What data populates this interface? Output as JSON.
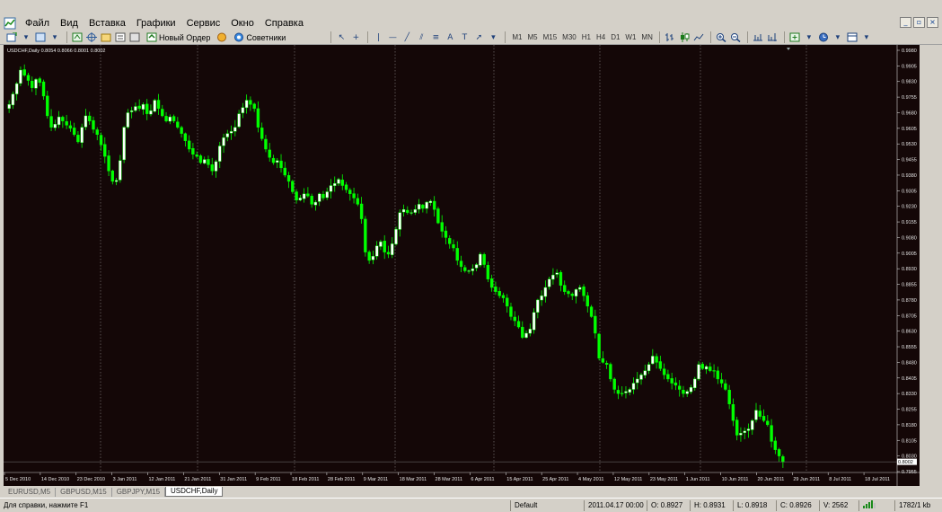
{
  "menubar": {
    "items": [
      "Файл",
      "Вид",
      "Вставка",
      "Графики",
      "Сервис",
      "Окно",
      "Справка"
    ],
    "window_controls": [
      "_",
      "▫",
      "×"
    ]
  },
  "toolbar": {
    "new_order_label": "Новый Ордер",
    "experts_label": "Советники",
    "timeframes": [
      "M1",
      "M5",
      "M15",
      "M30",
      "H1",
      "H4",
      "D1",
      "W1",
      "MN"
    ]
  },
  "chart": {
    "header": "USDCHF,Daily  0.8054 0.8066 0.8001 0.8002",
    "current_price_label": "0.8002",
    "bull_color": "#ffffff",
    "bear_color": "#00ff00",
    "background": "#140707"
  },
  "chart_data": {
    "type": "candlestick",
    "symbol": "USDCHF",
    "timeframe": "Daily",
    "ylim": [
      0.7955,
      0.998
    ],
    "y_ticks": [
      "0.9980",
      "0.9905",
      "0.9830",
      "0.9755",
      "0.9680",
      "0.9605",
      "0.9530",
      "0.9455",
      "0.9380",
      "0.9305",
      "0.9230",
      "0.9155",
      "0.9080",
      "0.9005",
      "0.8930",
      "0.8855",
      "0.8780",
      "0.8705",
      "0.8630",
      "0.8555",
      "0.8480",
      "0.8405",
      "0.8330",
      "0.8255",
      "0.8180",
      "0.8105",
      "0.8030",
      "0.7955"
    ],
    "x_ticks": [
      "5 Dec 2010",
      "14 Dec 2010",
      "23 Dec 2010",
      "3 Jan 2011",
      "12 Jan 2011",
      "21 Jan 2011",
      "31 Jan 2011",
      "9 Feb 2011",
      "18 Feb 2011",
      "28 Feb 2011",
      "9 Mar 2011",
      "18 Mar 2011",
      "28 Mar 2011",
      "6 Apr 2011",
      "15 Apr 2011",
      "25 Apr 2011",
      "4 May 2011",
      "12 May 2011",
      "23 May 2011",
      "1 Jun 2011",
      "10 Jun 2011",
      "20 Jun 2011",
      "29 Jun 2011",
      "8 Jul 2011",
      "18 Jul 2011"
    ],
    "close_path": [
      0.972,
      0.977,
      0.982,
      0.9885,
      0.986,
      0.9835,
      0.98,
      0.984,
      0.9825,
      0.976,
      0.9665,
      0.961,
      0.9625,
      0.966,
      0.964,
      0.962,
      0.9605,
      0.9575,
      0.954,
      0.961,
      0.9665,
      0.964,
      0.96,
      0.9575,
      0.9525,
      0.947,
      0.94,
      0.935,
      0.9355,
      0.945,
      0.961,
      0.968,
      0.969,
      0.971,
      0.97,
      0.972,
      0.9675,
      0.969,
      0.974,
      0.97,
      0.9665,
      0.964,
      0.966,
      0.964,
      0.961,
      0.958,
      0.9545,
      0.9505,
      0.948,
      0.947,
      0.944,
      0.9455,
      0.943,
      0.94,
      0.9445,
      0.952,
      0.956,
      0.958,
      0.959,
      0.961,
      0.9675,
      0.9705,
      0.974,
      0.972,
      0.97,
      0.961,
      0.9555,
      0.9505,
      0.9465,
      0.944,
      0.945,
      0.9415,
      0.938,
      0.935,
      0.93,
      0.926,
      0.927,
      0.929,
      0.928,
      0.924,
      0.925,
      0.929,
      0.927,
      0.93,
      0.933,
      0.934,
      0.936,
      0.933,
      0.931,
      0.929,
      0.927,
      0.924,
      0.917,
      0.901,
      0.897,
      0.899,
      0.904,
      0.906,
      0.901,
      0.9,
      0.905,
      0.912,
      0.92,
      0.9215,
      0.92,
      0.92,
      0.9215,
      0.924,
      0.922,
      0.925,
      0.9255,
      0.9215,
      0.915,
      0.911,
      0.908,
      0.905,
      0.903,
      0.897,
      0.894,
      0.892,
      0.892,
      0.893,
      0.895,
      0.9,
      0.895,
      0.888,
      0.884,
      0.882,
      0.88,
      0.879,
      0.875,
      0.87,
      0.868,
      0.865,
      0.86,
      0.862,
      0.864,
      0.872,
      0.878,
      0.88,
      0.884,
      0.888,
      0.89,
      0.891,
      0.885,
      0.882,
      0.881,
      0.88,
      0.883,
      0.884,
      0.88,
      0.875,
      0.87,
      0.862,
      0.85,
      0.848,
      0.847,
      0.84,
      0.835,
      0.833,
      0.833,
      0.834,
      0.835,
      0.838,
      0.84,
      0.842,
      0.844,
      0.847,
      0.851,
      0.848,
      0.845,
      0.842,
      0.84,
      0.838,
      0.837,
      0.835,
      0.833,
      0.834,
      0.836,
      0.84,
      0.847,
      0.845,
      0.846,
      0.844,
      0.844,
      0.84,
      0.838,
      0.835,
      0.828,
      0.82,
      0.813,
      0.814,
      0.815,
      0.816,
      0.82,
      0.825,
      0.822,
      0.82,
      0.818,
      0.81,
      0.806,
      0.803,
      0.8002
    ]
  },
  "tabs": [
    "EURUSD,M5",
    "GBPUSD,M15",
    "GBPJPY,M15",
    "USDCHF,Daily"
  ],
  "active_tab_index": 3,
  "statusbar": {
    "help": "Для справки, нажмите F1",
    "profile": "Default",
    "datetime": "2011.04.17 00:00",
    "open": "O: 0.8927",
    "high": "H: 0.8931",
    "low": "L: 0.8918",
    "close": "C: 0.8926",
    "volume": "V: 2562",
    "traffic": "1782/1 kb"
  }
}
